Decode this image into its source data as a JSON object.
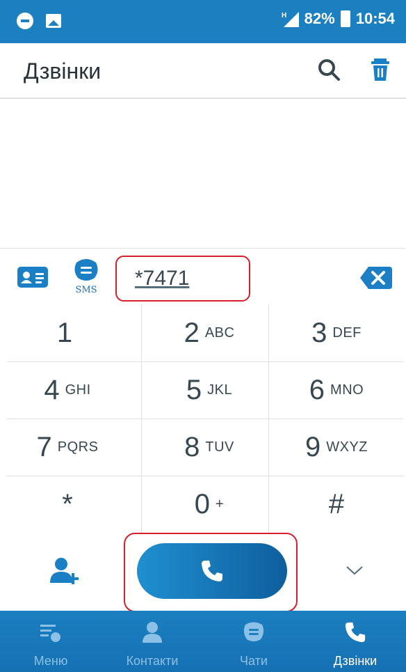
{
  "status_bar": {
    "battery": "82%",
    "time": "10:54",
    "network": "H"
  },
  "app_bar": {
    "title": "Дзвінки"
  },
  "dialer": {
    "number": "*7471",
    "sms_label": "SMS",
    "keys": [
      {
        "digit": "1",
        "letters": ""
      },
      {
        "digit": "2",
        "letters": "ABC"
      },
      {
        "digit": "3",
        "letters": "DEF"
      },
      {
        "digit": "4",
        "letters": "GHI"
      },
      {
        "digit": "5",
        "letters": "JKL"
      },
      {
        "digit": "6",
        "letters": "MNO"
      },
      {
        "digit": "7",
        "letters": "PQRS"
      },
      {
        "digit": "8",
        "letters": "TUV"
      },
      {
        "digit": "9",
        "letters": "WXYZ"
      },
      {
        "digit": "*",
        "letters": ""
      },
      {
        "digit": "0",
        "letters": "+"
      },
      {
        "digit": "#",
        "letters": ""
      }
    ]
  },
  "bottom_nav": [
    {
      "label": "Меню",
      "icon": "menu-icon"
    },
    {
      "label": "Контакти",
      "icon": "contacts-icon"
    },
    {
      "label": "Чати",
      "icon": "chat-icon"
    },
    {
      "label": "Дзвінки",
      "icon": "phone-icon",
      "active": true
    }
  ],
  "colors": {
    "primary": "#1b7fc0",
    "highlight": "#d81e2c",
    "text": "#37474f"
  }
}
